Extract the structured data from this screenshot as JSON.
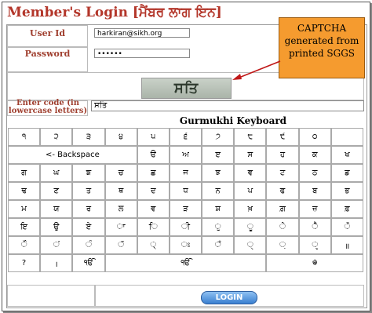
{
  "title": "Member's Login [ਮੈਂਬਰ ਲਾਗ ਇਨ]",
  "form": {
    "user_id_label": "User Id",
    "user_id_value": "harkiran@sikh.org",
    "password_label": "Password",
    "password_value": "••••••",
    "enter_code_label": "Enter code (in lowercase letters)",
    "enter_code_value": "ਸਤਿ",
    "captcha_text": "ਸਤਿ"
  },
  "callout": {
    "text": "CAPTCHA generated from printed SGGS"
  },
  "keyboard": {
    "title": "Gurmukhi Keyboard",
    "rows": [
      [
        "੧",
        "੨",
        "੩",
        "੪",
        "੫",
        "੬",
        "੭",
        "੮",
        "੯",
        "੦",
        ""
      ],
      [
        "<- Backspace",
        "ੳ",
        "ਅ",
        "ੲ",
        "ਸ",
        "ਹ",
        "ਕ",
        "ਖ"
      ],
      [
        "ਗ",
        "ਘ",
        "ਙ",
        "ਚ",
        "ਛ",
        "ਜ",
        "ਝ",
        "ਞ",
        "ਟ",
        "ਠ",
        "ਡ"
      ],
      [
        "ਢ",
        "ਣ",
        "ਤ",
        "ਥ",
        "ਦ",
        "ਧ",
        "ਨ",
        "ਪ",
        "ਫ",
        "ਬ",
        "ਭ"
      ],
      [
        "ਮ",
        "ਯ",
        "ਰ",
        "ਲ",
        "ਵ",
        "ੜ",
        "ਸ਼",
        "ਖ਼",
        "ਗ਼",
        "ਜ਼",
        "ਫ਼"
      ],
      [
        "ਇ",
        "ਉ",
        "ਏ",
        "ਾ",
        "ਿ",
        "ੀ",
        "ੁ",
        "ੂ",
        "ੇ",
        "ੈ",
        "ੋ"
      ],
      [
        "ੌ",
        "ਂ",
        "ੰ",
        "ੱ",
        "੍",
        "ਃ",
        "ਁ",
        "ੑ",
        "਼",
        "ੵ",
        "॥"
      ],
      [
        "?",
        "।",
        "ੴ",
        "ੴ",
        "☬"
      ]
    ]
  },
  "login_label": "LOGIN"
}
